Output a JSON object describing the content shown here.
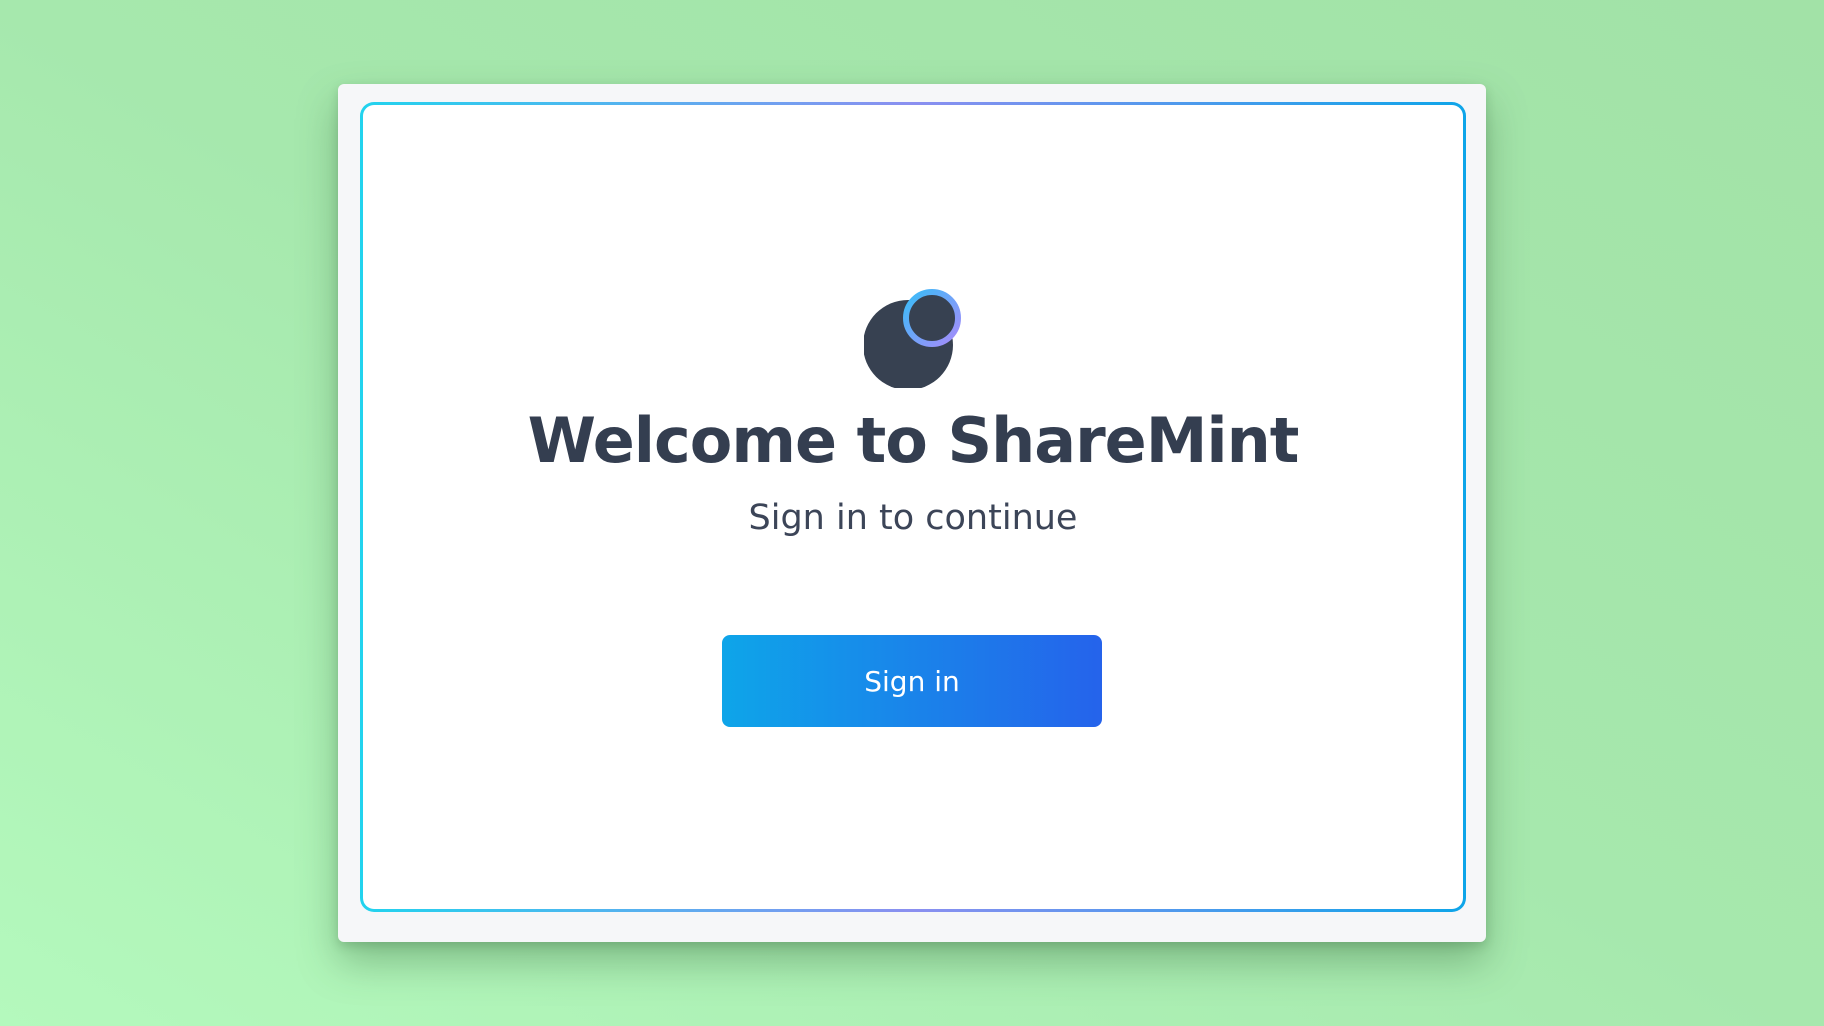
{
  "app": {
    "title": "Welcome to ShareMint",
    "subtitle": "Sign in to continue"
  },
  "actions": {
    "signin_label": "Sign in"
  },
  "logo": {
    "icon": "sharemint-logo-icon",
    "colors": {
      "circle": "#374151",
      "ring_start": "#3b82f6",
      "ring_end": "#a78bfa"
    }
  },
  "theme": {
    "background": "#a6e8ad",
    "frame_gradient": [
      "#22d3ee",
      "#8b8ff0",
      "#0ea5e9"
    ],
    "button_gradient": [
      "#0ea5e9",
      "#2563eb"
    ],
    "text_color": "#343e50"
  }
}
